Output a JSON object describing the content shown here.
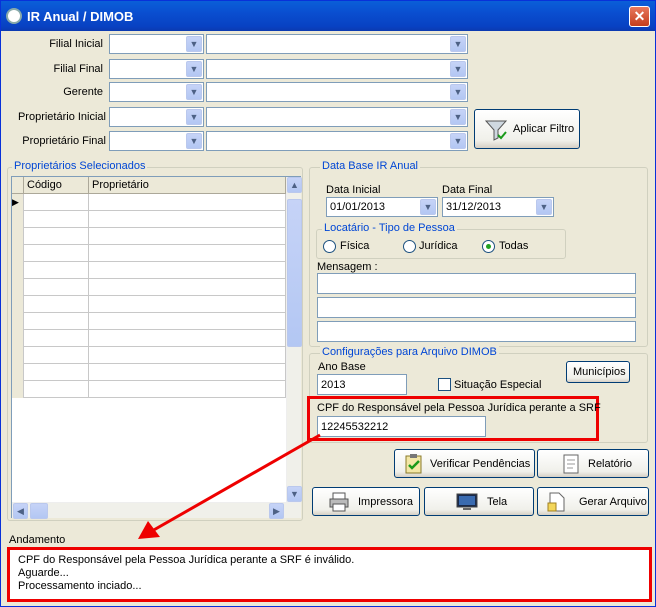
{
  "window": {
    "title": "IR Anual / DIMOB",
    "close": "✕"
  },
  "filters": {
    "filial_inicial": "Filial Inicial",
    "filial_final": "Filial Final",
    "gerente": "Gerente",
    "proprietario_inicial": "Proprietário Inicial",
    "proprietario_final": "Proprietário Final",
    "apply_label": "Aplicar Filtro"
  },
  "proprietarios": {
    "title": "Proprietários Selecionados",
    "columns": [
      "Código",
      "Proprietário"
    ]
  },
  "data_base": {
    "title": "Data Base IR Anual",
    "inicial_label": "Data Inicial",
    "inicial_value": "01/01/2013",
    "final_label": "Data Final",
    "final_value": "31/12/2013"
  },
  "locatario": {
    "title": "Locatário - Tipo de Pessoa",
    "fisica": "Física",
    "juridica": "Jurídica",
    "todas": "Todas",
    "selected": "Todas"
  },
  "mensagem": {
    "label": "Mensagem :"
  },
  "dimob": {
    "title": "Configurações para Arquivo DIMOB",
    "ano_label": "Ano Base",
    "ano_value": "2013",
    "situacao_label": "Situação Especial",
    "municipios_label": "Municípios",
    "cpf_label": "CPF do Responsável pela Pessoa  Jurídica perante a SRF",
    "cpf_value": "12245532212"
  },
  "actions": {
    "verificar": "Verificar Pendências",
    "relatorio": "Relatório",
    "impressora": "Impressora",
    "tela": "Tela",
    "gerar": "Gerar Arquivo"
  },
  "andamento": {
    "label": "Andamento",
    "lines": [
      "CPF do Responsável pela Pessoa  Jurídica perante a SRF é inválido.",
      "Aguarde...",
      "Processamento inciado..."
    ]
  },
  "colors": {
    "highlight": "#e00000",
    "title_bar": "#0a4ed0"
  },
  "icons": [
    "app-icon",
    "close-icon",
    "dropdown-arrow-icon",
    "filter-icon",
    "clipboard-check-icon",
    "report-icon",
    "printer-icon",
    "screen-icon",
    "file-icon"
  ]
}
